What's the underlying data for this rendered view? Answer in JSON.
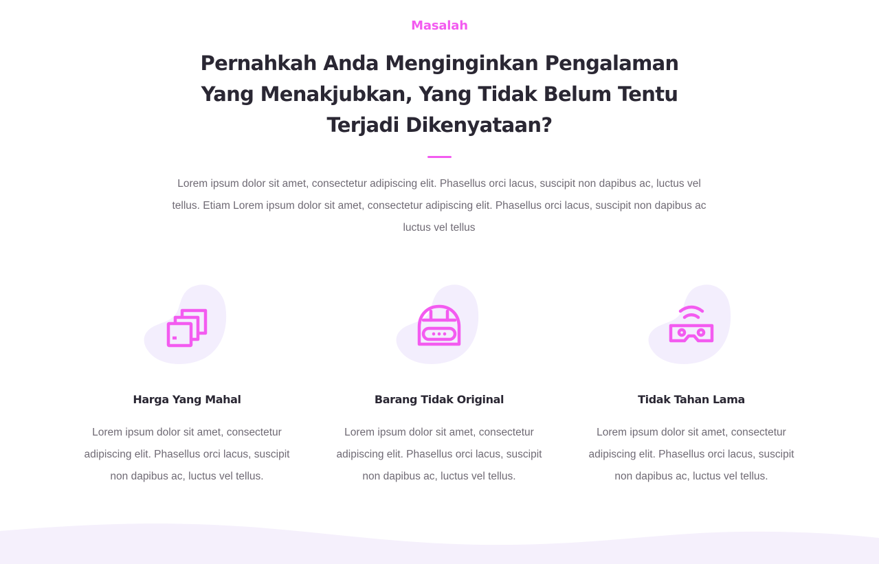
{
  "section": {
    "eyebrow": "Masalah",
    "headline": "Pernahkah Anda Menginginkan Pengalaman Yang Menakjubkan, Yang Tidak Belum Tentu Terjadi Dikenyataan?",
    "intro": "Lorem ipsum dolor sit amet, consectetur adipiscing elit. Phasellus orci lacus, suscipit non dapibus ac, luctus vel tellus. Etiam Lorem ipsum dolor sit amet, consectetur adipiscing elit. Phasellus orci lacus, suscipit non dapibus ac luctus vel tellus"
  },
  "features": [
    {
      "icon": "stacked-cards-icon",
      "title": "Harga Yang Mahal",
      "text": "Lorem ipsum dolor sit amet, consectetur adipiscing elit. Phasellus orci lacus, suscipit non dapibus ac, luctus vel tellus."
    },
    {
      "icon": "vr-helmet-icon",
      "title": "Barang Tidak Original",
      "text": "Lorem ipsum dolor sit amet, consectetur adipiscing elit. Phasellus orci lacus, suscipit non dapibus ac, luctus vel tellus."
    },
    {
      "icon": "vr-goggles-wireless-icon",
      "title": "Tidak Tahan Lama",
      "text": "Lorem ipsum dolor sit amet, consectetur adipiscing elit. Phasellus orci lacus, suscipit non dapibus ac, luctus vel tellus."
    }
  ],
  "colors": {
    "accent": "#f35bf0",
    "heading": "#2a2733",
    "body": "#6f6a74",
    "blob": "#f3eefd",
    "wave": "#f5f0fc",
    "background": "#ffffff"
  }
}
